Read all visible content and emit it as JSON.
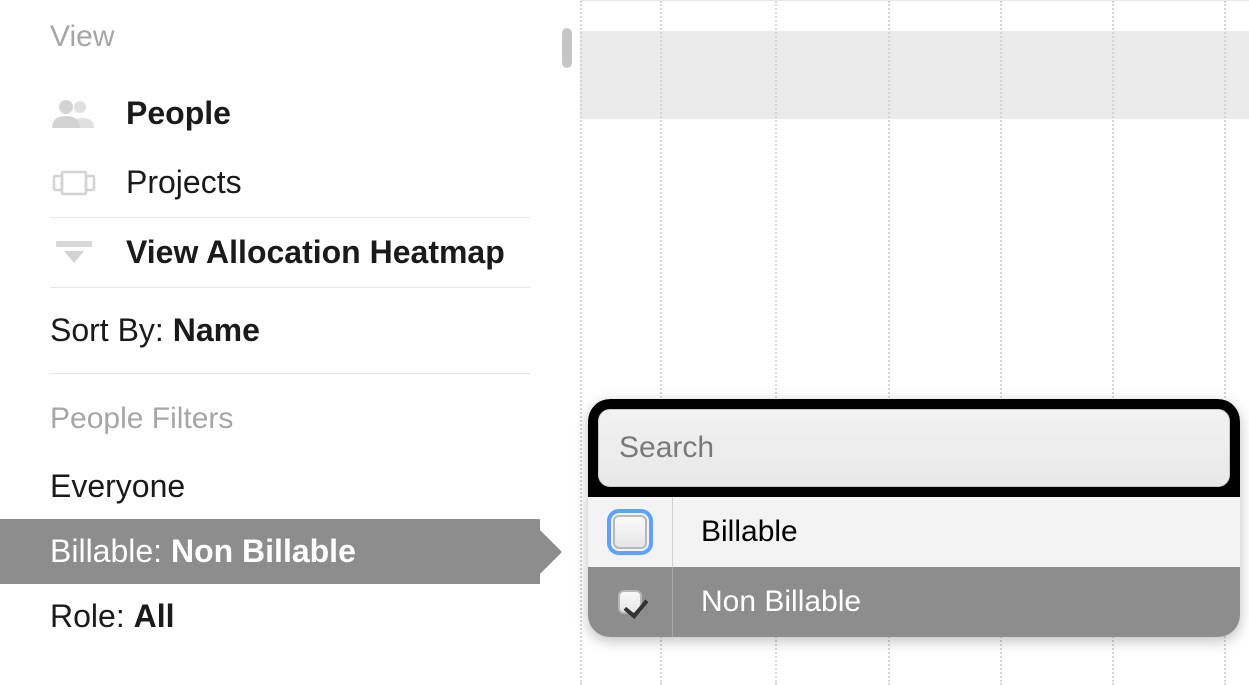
{
  "sidebar": {
    "view_header": "View",
    "nav": {
      "people": "People",
      "projects": "Projects",
      "heatmap": "View Allocation Heatmap"
    },
    "sort": {
      "prefix": "Sort By: ",
      "value": "Name"
    },
    "filters_header": "People Filters",
    "filters": {
      "everyone": "Everyone",
      "billable": {
        "prefix": "Billable: ",
        "value": "Non Billable"
      },
      "role": {
        "prefix": "Role: ",
        "value": "All"
      }
    }
  },
  "popup": {
    "search_placeholder": "Search",
    "options": [
      {
        "label": "Billable",
        "checked": false,
        "focused": true
      },
      {
        "label": "Non Billable",
        "checked": true,
        "focused": false
      }
    ]
  },
  "grid": {
    "column_offsets": [
      0,
      80,
      195,
      308,
      420,
      532,
      644
    ]
  }
}
